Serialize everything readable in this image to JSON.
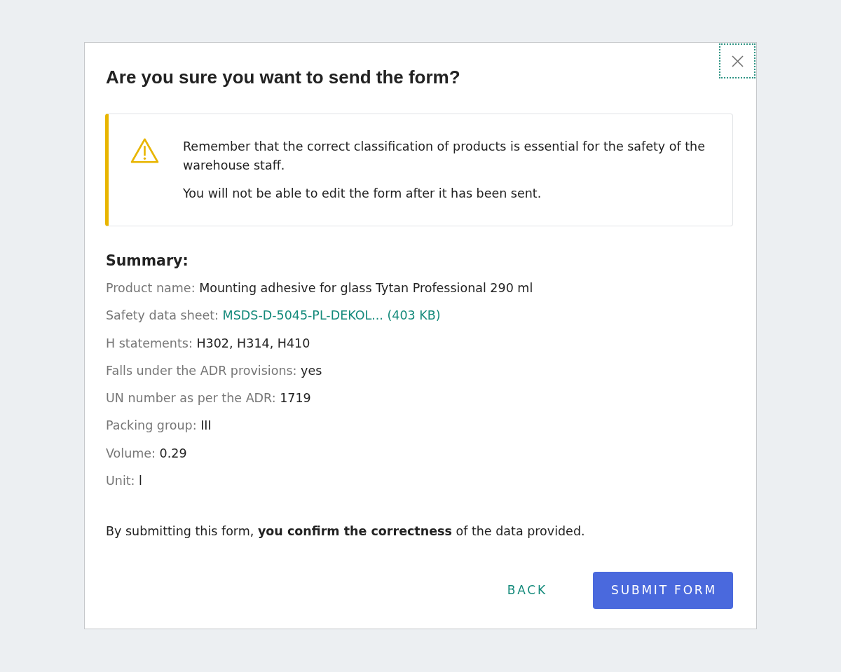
{
  "dialog": {
    "title": "Are you sure you want to send the form?",
    "close_button": {
      "focused": true
    }
  },
  "alert": {
    "kind": "warning",
    "paragraphs": [
      "Remember that the correct classification of products is essential for the safety of the warehouse staff.",
      "You will not be able to edit the form after it has been sent."
    ]
  },
  "summary": {
    "heading": "Summary:",
    "rows": [
      {
        "kind": "text",
        "label": "Product name:",
        "value": "Mounting adhesive for glass Tytan Professional 290 ml"
      },
      {
        "kind": "link",
        "label": "Safety data sheet:",
        "value": "MSDS-D-5045-PL-DEKOL... (403 KB)"
      },
      {
        "kind": "text",
        "label": "H statements:",
        "value": "H302, H314, H410"
      },
      {
        "kind": "text",
        "label": "Falls under the ADR provisions:",
        "value": "yes"
      },
      {
        "kind": "text",
        "label": "UN number as per the ADR:",
        "value": "1719"
      },
      {
        "kind": "text",
        "label": "Packing group:",
        "value": "III"
      },
      {
        "kind": "text",
        "label": "Volume:",
        "value": "0.29"
      },
      {
        "kind": "text",
        "label": "Unit:",
        "value": "l"
      }
    ]
  },
  "confirmation": "By submitting this form, **you confirm the correctness** of the data provided.",
  "buttons": [
    {
      "kind": "text",
      "label": "BACK"
    },
    {
      "kind": "primary",
      "label": "SUBMIT FORM"
    }
  ]
}
